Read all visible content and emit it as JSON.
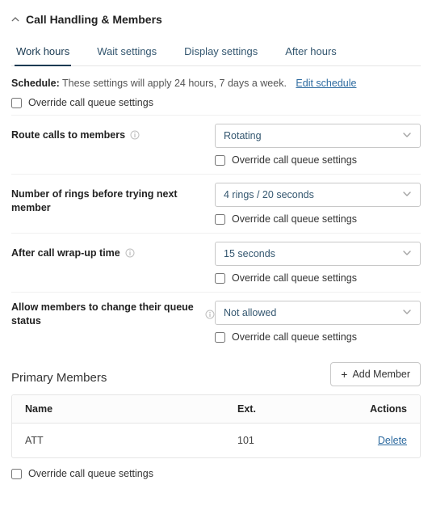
{
  "header": {
    "title": "Call Handling & Members"
  },
  "tabs": [
    {
      "label": "Work hours",
      "active": true
    },
    {
      "label": "Wait settings",
      "active": false
    },
    {
      "label": "Display settings",
      "active": false
    },
    {
      "label": "After hours",
      "active": false
    }
  ],
  "schedule": {
    "label": "Schedule:",
    "text": "These settings will apply 24 hours, 7 days a week.",
    "edit_label": "Edit schedule"
  },
  "top_override": {
    "label": "Override call queue settings"
  },
  "settings": {
    "route": {
      "label": "Route calls to members",
      "value": "Rotating",
      "override_label": "Override call queue settings"
    },
    "rings": {
      "label": "Number of rings before trying next member",
      "value": "4 rings / 20 seconds",
      "override_label": "Override call queue settings"
    },
    "wrapup": {
      "label": "After call wrap-up time",
      "value": "15 seconds",
      "override_label": "Override call queue settings"
    },
    "allow_change": {
      "label": "Allow members to change their queue status",
      "value": "Not allowed",
      "override_label": "Override call queue settings"
    }
  },
  "members": {
    "title": "Primary Members",
    "add_label": "Add Member",
    "columns": {
      "name": "Name",
      "ext": "Ext.",
      "actions": "Actions"
    },
    "rows": [
      {
        "name": "ATT",
        "ext": "101",
        "action": "Delete"
      }
    ]
  },
  "bottom_override": {
    "label": "Override call queue settings"
  }
}
